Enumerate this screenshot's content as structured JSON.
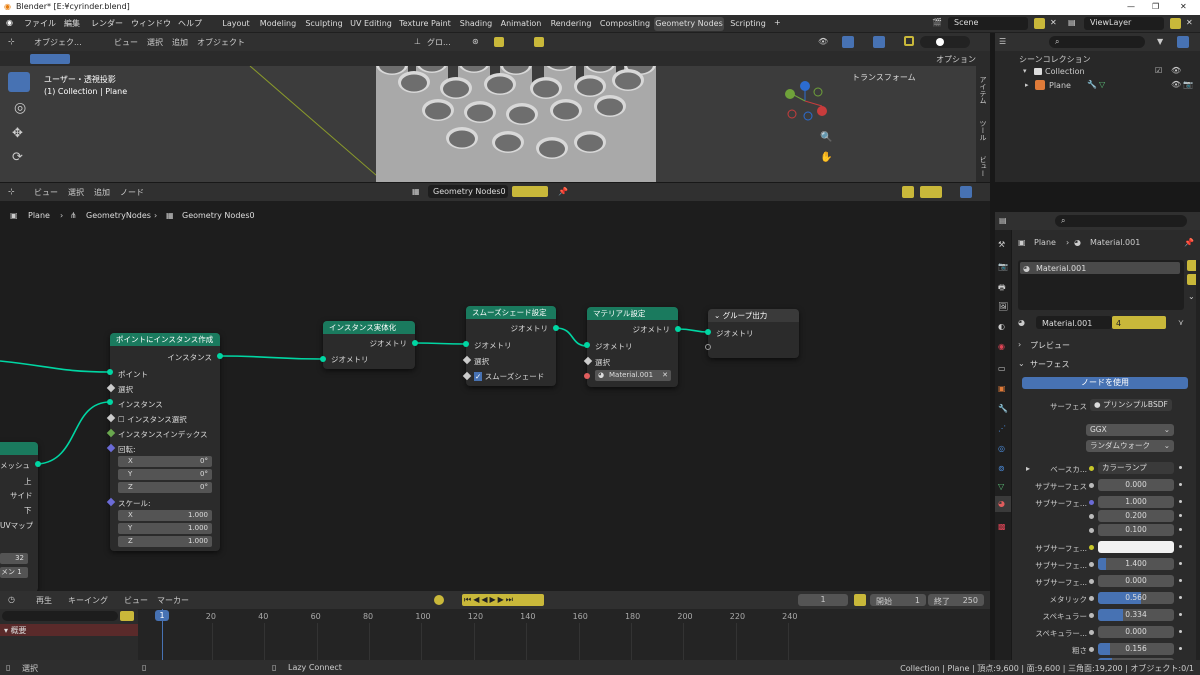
{
  "titlebar": {
    "title": "Blender* [E:¥cyrinder.blend]"
  },
  "menu": {
    "file": "ファイル",
    "edit": "編集",
    "render": "レンダー",
    "window": "ウィンドウ",
    "help": "ヘルプ"
  },
  "workspaces": [
    "Layout",
    "Modeling",
    "Sculpting",
    "UV Editing",
    "Texture Paint",
    "Shading",
    "Animation",
    "Rendering",
    "Compositing",
    "Geometry Nodes",
    "Scripting"
  ],
  "scene": {
    "name": "Scene",
    "view_layer": "ViewLayer"
  },
  "viewport": {
    "mode": "オブジェク...",
    "menus": [
      "ビュー",
      "選択",
      "追加",
      "オブジェクト"
    ],
    "transform_orient": "グロ...",
    "options": "オプション",
    "view_name": "ユーザー・透視投影",
    "object_info": "(1) Collection | Plane",
    "transform_panel": "トランスフォーム",
    "tabs": [
      "アイテム",
      "ツール",
      "ビュー"
    ]
  },
  "outliner": {
    "title": "シーンコレクション",
    "collection": "Collection",
    "plane": "Plane"
  },
  "node_editor": {
    "menus": [
      "ビュー",
      "選択",
      "追加",
      "ノード"
    ],
    "tree_name": "Geometry Nodes0",
    "breadcrumb": [
      "Plane",
      "GeometryNodes",
      "Geometry Nodes0"
    ]
  },
  "nodes": {
    "instance_on_points": {
      "title": "ポイントにインスタンス作成",
      "out": "インスタンス",
      "points": "ポイント",
      "selection": "選択",
      "instance": "インスタンス",
      "pick_instance": "インスタンス選択",
      "instance_index": "インスタンスインデックス",
      "rotation": "回転:",
      "rot": [
        {
          "axis": "X",
          "val": "0°"
        },
        {
          "axis": "Y",
          "val": "0°"
        },
        {
          "axis": "Z",
          "val": "0°"
        }
      ],
      "scale": "スケール:",
      "scl": [
        {
          "axis": "X",
          "val": "1.000"
        },
        {
          "axis": "Y",
          "val": "1.000"
        },
        {
          "axis": "Z",
          "val": "1.000"
        }
      ]
    },
    "realize": {
      "title": "インスタンス実体化",
      "out": "ジオメトリ",
      "in": "ジオメトリ"
    },
    "smooth": {
      "title": "スムーズシェード設定",
      "out": "ジオメトリ",
      "in": "ジオメトリ",
      "selection": "選択",
      "shade_smooth": "スムーズシェード"
    },
    "material": {
      "title": "マテリアル設定",
      "out": "ジオメトリ",
      "in": "ジオメトリ",
      "selection": "選択",
      "material": "Material.001"
    },
    "group_out": {
      "title": "グループ出力",
      "in": "ジオメトリ"
    },
    "left_node": {
      "mesh": "メッシュ",
      "top": "上",
      "side": "サイド",
      "bottom": "下",
      "uvmap": "UVマップ",
      "val1": "32",
      "lbl2": "メン",
      "val2": "1"
    }
  },
  "properties": {
    "breadcrumb": [
      "Plane",
      "Material.001"
    ],
    "slot": "Material.001",
    "material_name": "Material.001",
    "users": "4",
    "preview": "プレビュー",
    "surface_panel": "サーフェス",
    "use_nodes": "ノードを使用",
    "surface_label": "サーフェス",
    "surface_value": "プリンシプルBSDF",
    "distribution": "GGX",
    "sss_method": "ランダムウォーク",
    "rows": [
      {
        "label": "ベースカ...",
        "value": "カラーランプ"
      },
      {
        "label": "サブサーフェス",
        "value": "0.000"
      },
      {
        "label": "サブサーフェ...",
        "value": "1.000"
      },
      {
        "label": "",
        "value": "0.200"
      },
      {
        "label": "",
        "value": "0.100"
      },
      {
        "label": "サブサーフェ...",
        "value": ""
      },
      {
        "label": "サブサーフェ...",
        "value": "1.400"
      },
      {
        "label": "サブサーフェ...",
        "value": "0.000"
      },
      {
        "label": "メタリック",
        "value": "0.560"
      },
      {
        "label": "スペキュラー",
        "value": "0.334"
      },
      {
        "label": "スペキュラー...",
        "value": "0.000"
      },
      {
        "label": "粗さ",
        "value": "0.156"
      },
      {
        "label": "異方性",
        "value": "0.187"
      }
    ]
  },
  "timeline": {
    "menus": [
      "再生",
      "キーイング",
      "ビュー",
      "マーカー"
    ],
    "current": "1",
    "start_label": "開始",
    "start": "1",
    "end_label": "終了",
    "end": "250",
    "ticks": [
      "1",
      "20",
      "40",
      "60",
      "80",
      "100",
      "120",
      "140",
      "160",
      "180",
      "200",
      "220",
      "240"
    ],
    "summary": "概要"
  },
  "status": {
    "select": "選択",
    "lazy": "Lazy Connect",
    "stats": "Collection | Plane | 頂点:9,600 | 面:9,600 | 三角面:19,200 | オブジェクト:0/1"
  }
}
